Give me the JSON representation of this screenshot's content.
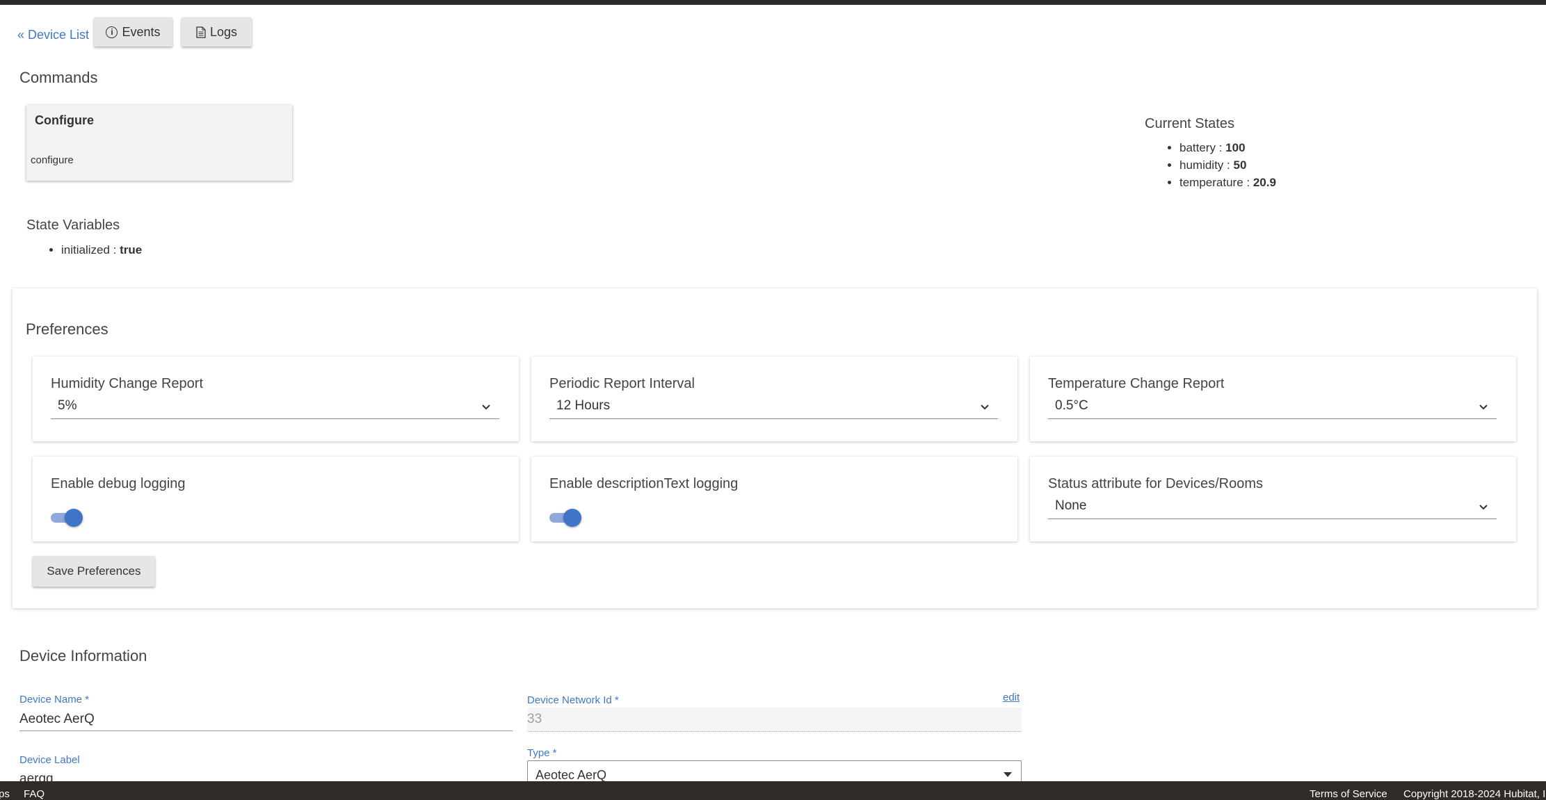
{
  "nav": {
    "back_link": "« Device List",
    "events_button": "Events",
    "logs_button": "Logs"
  },
  "commands": {
    "heading": "Commands",
    "card_title": "Configure",
    "card_command": "configure"
  },
  "current_states": {
    "heading": "Current States",
    "items": [
      {
        "key": "battery :",
        "value": "100"
      },
      {
        "key": "humidity :",
        "value": "50"
      },
      {
        "key": "temperature :",
        "value": "20.9"
      }
    ]
  },
  "state_variables": {
    "heading": "State Variables",
    "items": [
      {
        "key": "initialized :",
        "value": "true"
      }
    ]
  },
  "preferences": {
    "heading": "Preferences",
    "humidity_change": {
      "label": "Humidity Change Report",
      "value": "5%"
    },
    "periodic_interval": {
      "label": "Periodic Report Interval",
      "value": "12 Hours"
    },
    "temperature_change": {
      "label": "Temperature Change Report",
      "value": "0.5°C"
    },
    "debug_logging": {
      "label": "Enable debug logging",
      "enabled": true
    },
    "description_logging": {
      "label": "Enable descriptionText logging",
      "enabled": true
    },
    "status_attribute": {
      "label": "Status attribute for Devices/Rooms",
      "value": "None"
    },
    "save_button": "Save Preferences"
  },
  "device_info": {
    "heading": "Device Information",
    "name_label": "Device Name *",
    "name_value": "Aeotec AerQ",
    "network_id_label": "Device Network Id *",
    "network_id_value": "33",
    "edit_link": "edit",
    "device_label_label": "Device Label",
    "device_label_value": "aerqq",
    "type_label": "Type *",
    "type_value": "Aeotec AerQ"
  },
  "footer": {
    "left_partial": "ps",
    "faq": "FAQ",
    "terms": "Terms of Service",
    "copyright": "Copyright 2018-2024 Hubitat, I"
  },
  "colors": {
    "accent": "#3f78c3",
    "toggle_on": "#3f74c6",
    "topbar": "#2e2b28"
  }
}
